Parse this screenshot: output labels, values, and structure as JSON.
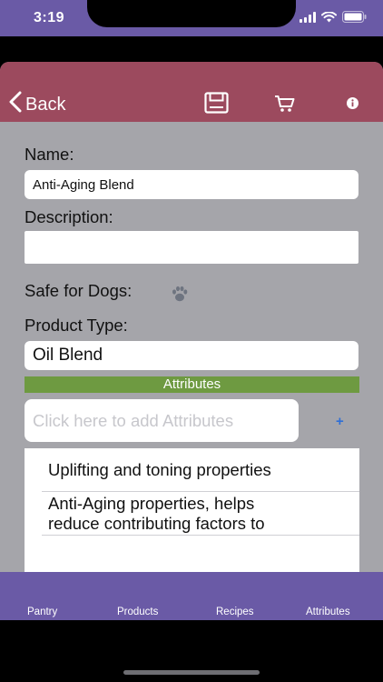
{
  "status_bar": {
    "time": "3:19"
  },
  "nav": {
    "back_label": "Back",
    "icons": [
      "save-icon",
      "cart-icon",
      "info-icon"
    ]
  },
  "form": {
    "name_label": "Name:",
    "name_value": "Anti-Aging Blend",
    "description_label": "Description:",
    "description_value": "",
    "safe_for_dogs_label": "Safe for Dogs:",
    "product_type_label": "Product Type:",
    "product_type_value": "Oil Blend"
  },
  "attributes": {
    "header": "Attributes",
    "add_placeholder": "Click here to add Attributes",
    "add_button": "+",
    "items": [
      "Uplifting and toning properties",
      "Anti-Aging properties, helps\nreduce contributing factors to"
    ]
  },
  "tabs": [
    {
      "label": "Pantry"
    },
    {
      "label": "Products"
    },
    {
      "label": "Recipes"
    },
    {
      "label": "Attributes"
    }
  ],
  "colors": {
    "status_bar": "#6a5aa6",
    "nav_bar": "#9c4a5e",
    "content_bg": "#a5a5aa",
    "attributes_bar": "#6e9a41",
    "tab_bar": "#6a5aa6",
    "add_button": "#2f6fd6"
  }
}
